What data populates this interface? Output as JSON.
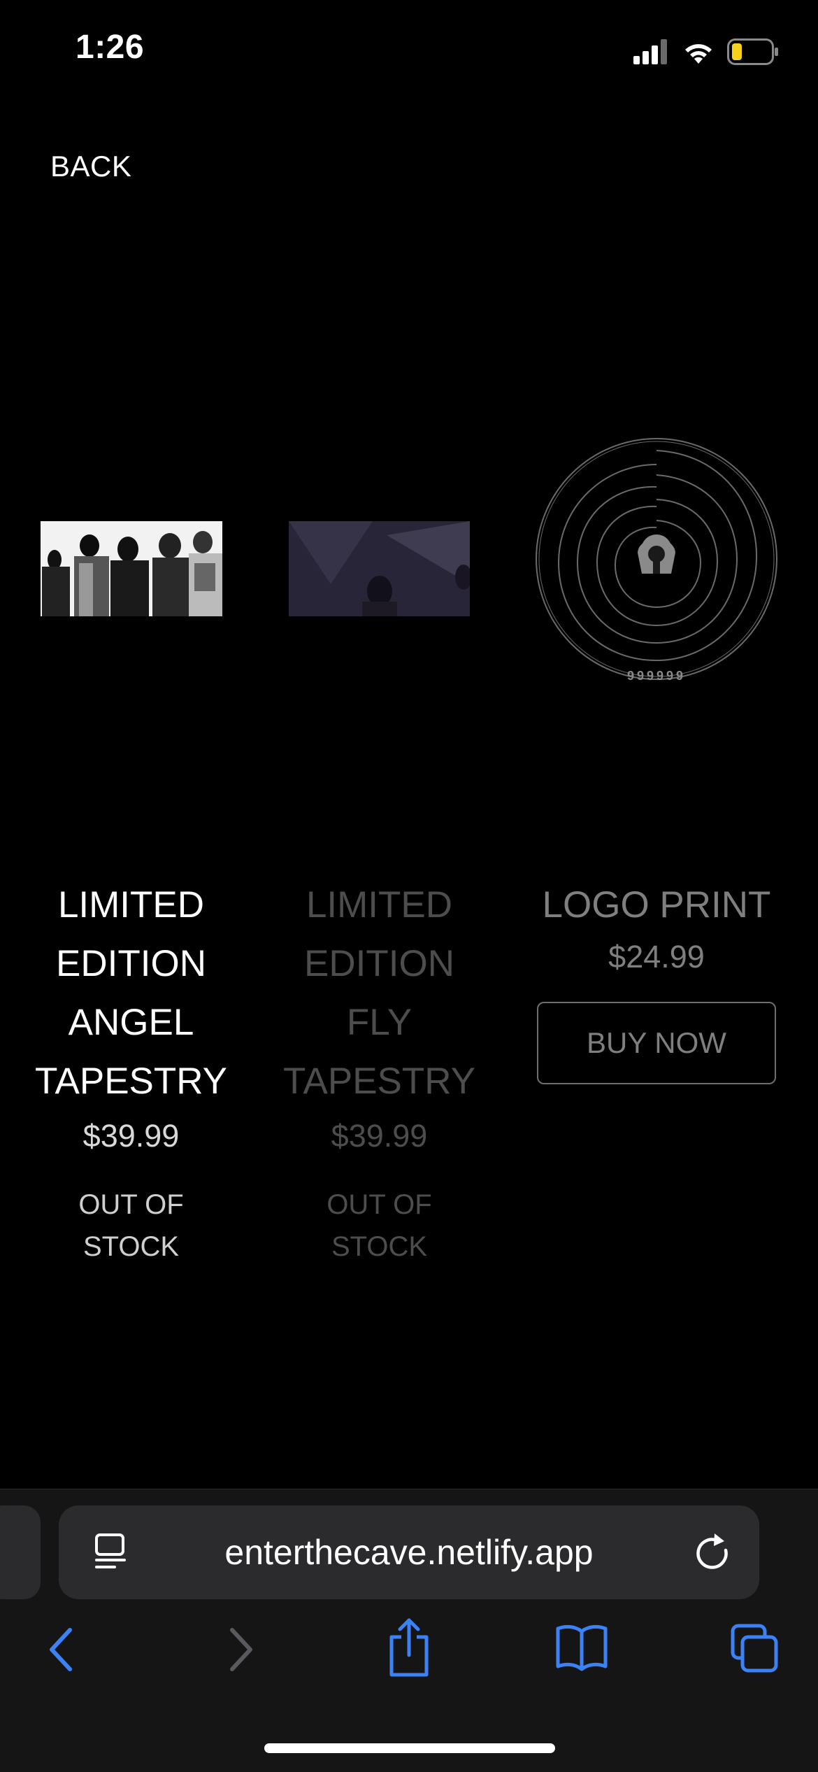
{
  "status_bar": {
    "time": "1:26",
    "battery_color": "#f4d21e"
  },
  "nav": {
    "back_label": "BACK"
  },
  "products": [
    {
      "name": "LIMITED EDITION ANGEL TAPESTRY",
      "price": "$39.99",
      "status": "OUT OF STOCK",
      "image_icon": "angel-tapestry-photo"
    },
    {
      "name": "LIMITED EDITION FLY TAPESTRY",
      "price": "$39.99",
      "status": "OUT OF STOCK",
      "image_icon": "fly-tapestry-photo"
    },
    {
      "name": "LOGO PRINT",
      "price": "$24.99",
      "button_label": "BUY NOW",
      "image_icon": "logo-print-artwork",
      "logo_text": "999999"
    }
  ],
  "browser": {
    "url": "enterthecave.netlify.app",
    "accent_color": "#3b82f6"
  }
}
